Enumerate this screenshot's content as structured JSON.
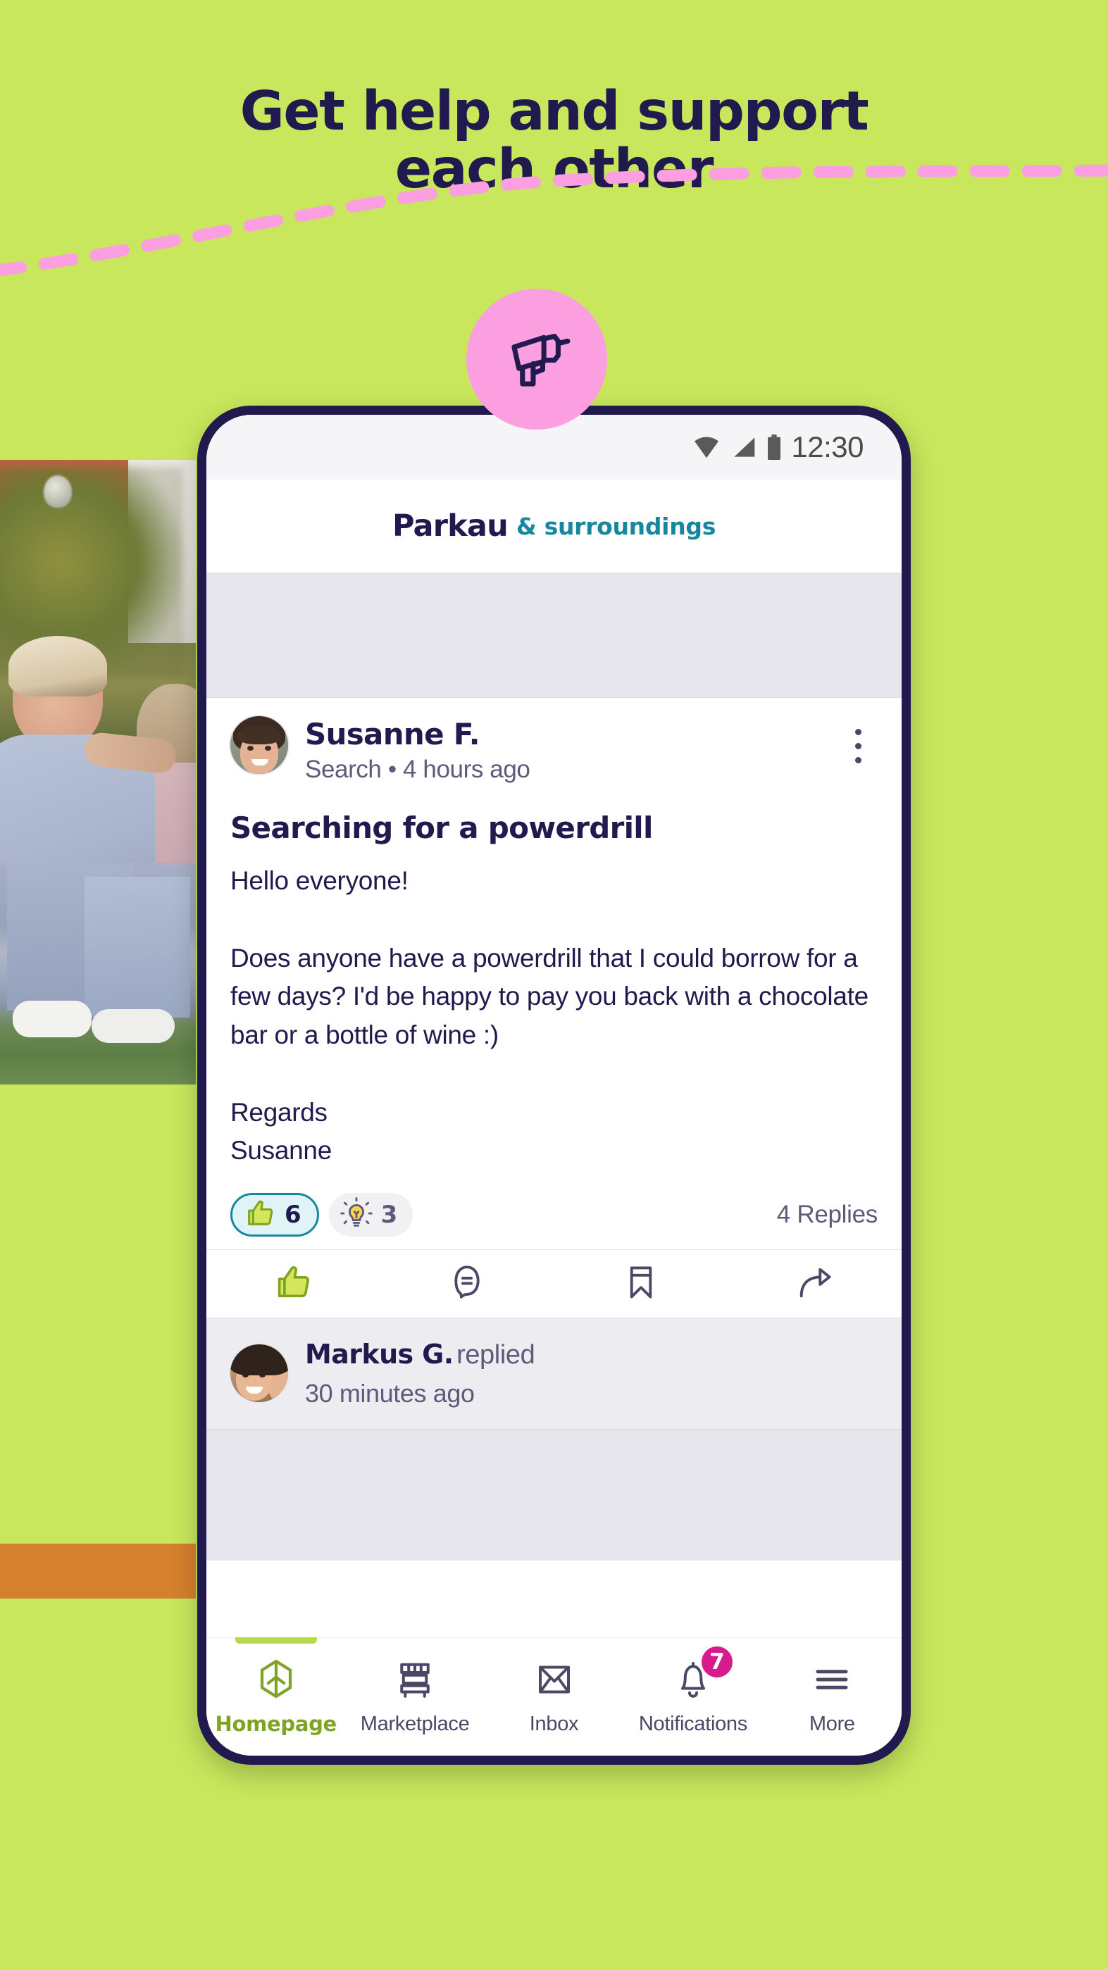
{
  "headline": "Get help and support\neach other",
  "theme": {
    "background_green": "#C8E75C",
    "navy": "#211A4E",
    "pink": "#FB9FE0",
    "teal": "#1787A0",
    "green_accent": "#B9D94B",
    "badge_pink": "#D81B8C",
    "orange_bar": "#D4802E"
  },
  "decoration": {
    "drill_badge_icon": "power-drill-icon",
    "dashed_path_color": "#FB9FE0"
  },
  "phone": {
    "statusbar": {
      "time": "12:30",
      "icons": [
        "wifi-icon",
        "cellular-signal-icon",
        "battery-icon"
      ]
    },
    "app_header": {
      "title": "Parkau",
      "subtitle": "& surroundings"
    },
    "post": {
      "author": "Susanne F.",
      "meta": "Search • 4 hours ago",
      "title": "Searching for a powerdrill",
      "body": "Hello everyone!\n\nDoes anyone have a powerdrill that I could borrow for a few days? I'd be happy to pay you back with a chocolate bar or a bottle of wine :)\n\nRegards\nSusanne",
      "menu_icon": "kebab-menu-icon",
      "reactions": [
        {
          "icon": "thumbs-up-icon",
          "count": "6",
          "active": true
        },
        {
          "icon": "lightbulb-icon",
          "count": "3",
          "active": false
        }
      ],
      "replies_label": "4 Replies",
      "actions": [
        {
          "icon": "thumbs-up-icon",
          "name": "like"
        },
        {
          "icon": "comment-bubble-icon",
          "name": "comment"
        },
        {
          "icon": "bookmark-icon",
          "name": "bookmark"
        },
        {
          "icon": "share-arrow-icon",
          "name": "share"
        }
      ]
    },
    "reply": {
      "author": "Markus G.",
      "verb": "replied",
      "time": "30 minutes ago"
    },
    "bottom_nav": [
      {
        "label": "Homepage",
        "icon": "leaf-home-icon",
        "active": true,
        "badge": ""
      },
      {
        "label": "Marketplace",
        "icon": "market-stall-icon",
        "active": false,
        "badge": ""
      },
      {
        "label": "Inbox",
        "icon": "envelope-icon",
        "active": false,
        "badge": ""
      },
      {
        "label": "Notifications",
        "icon": "bell-icon",
        "active": false,
        "badge": "7"
      },
      {
        "label": "More",
        "icon": "hamburger-menu-icon",
        "active": false,
        "badge": ""
      }
    ]
  }
}
